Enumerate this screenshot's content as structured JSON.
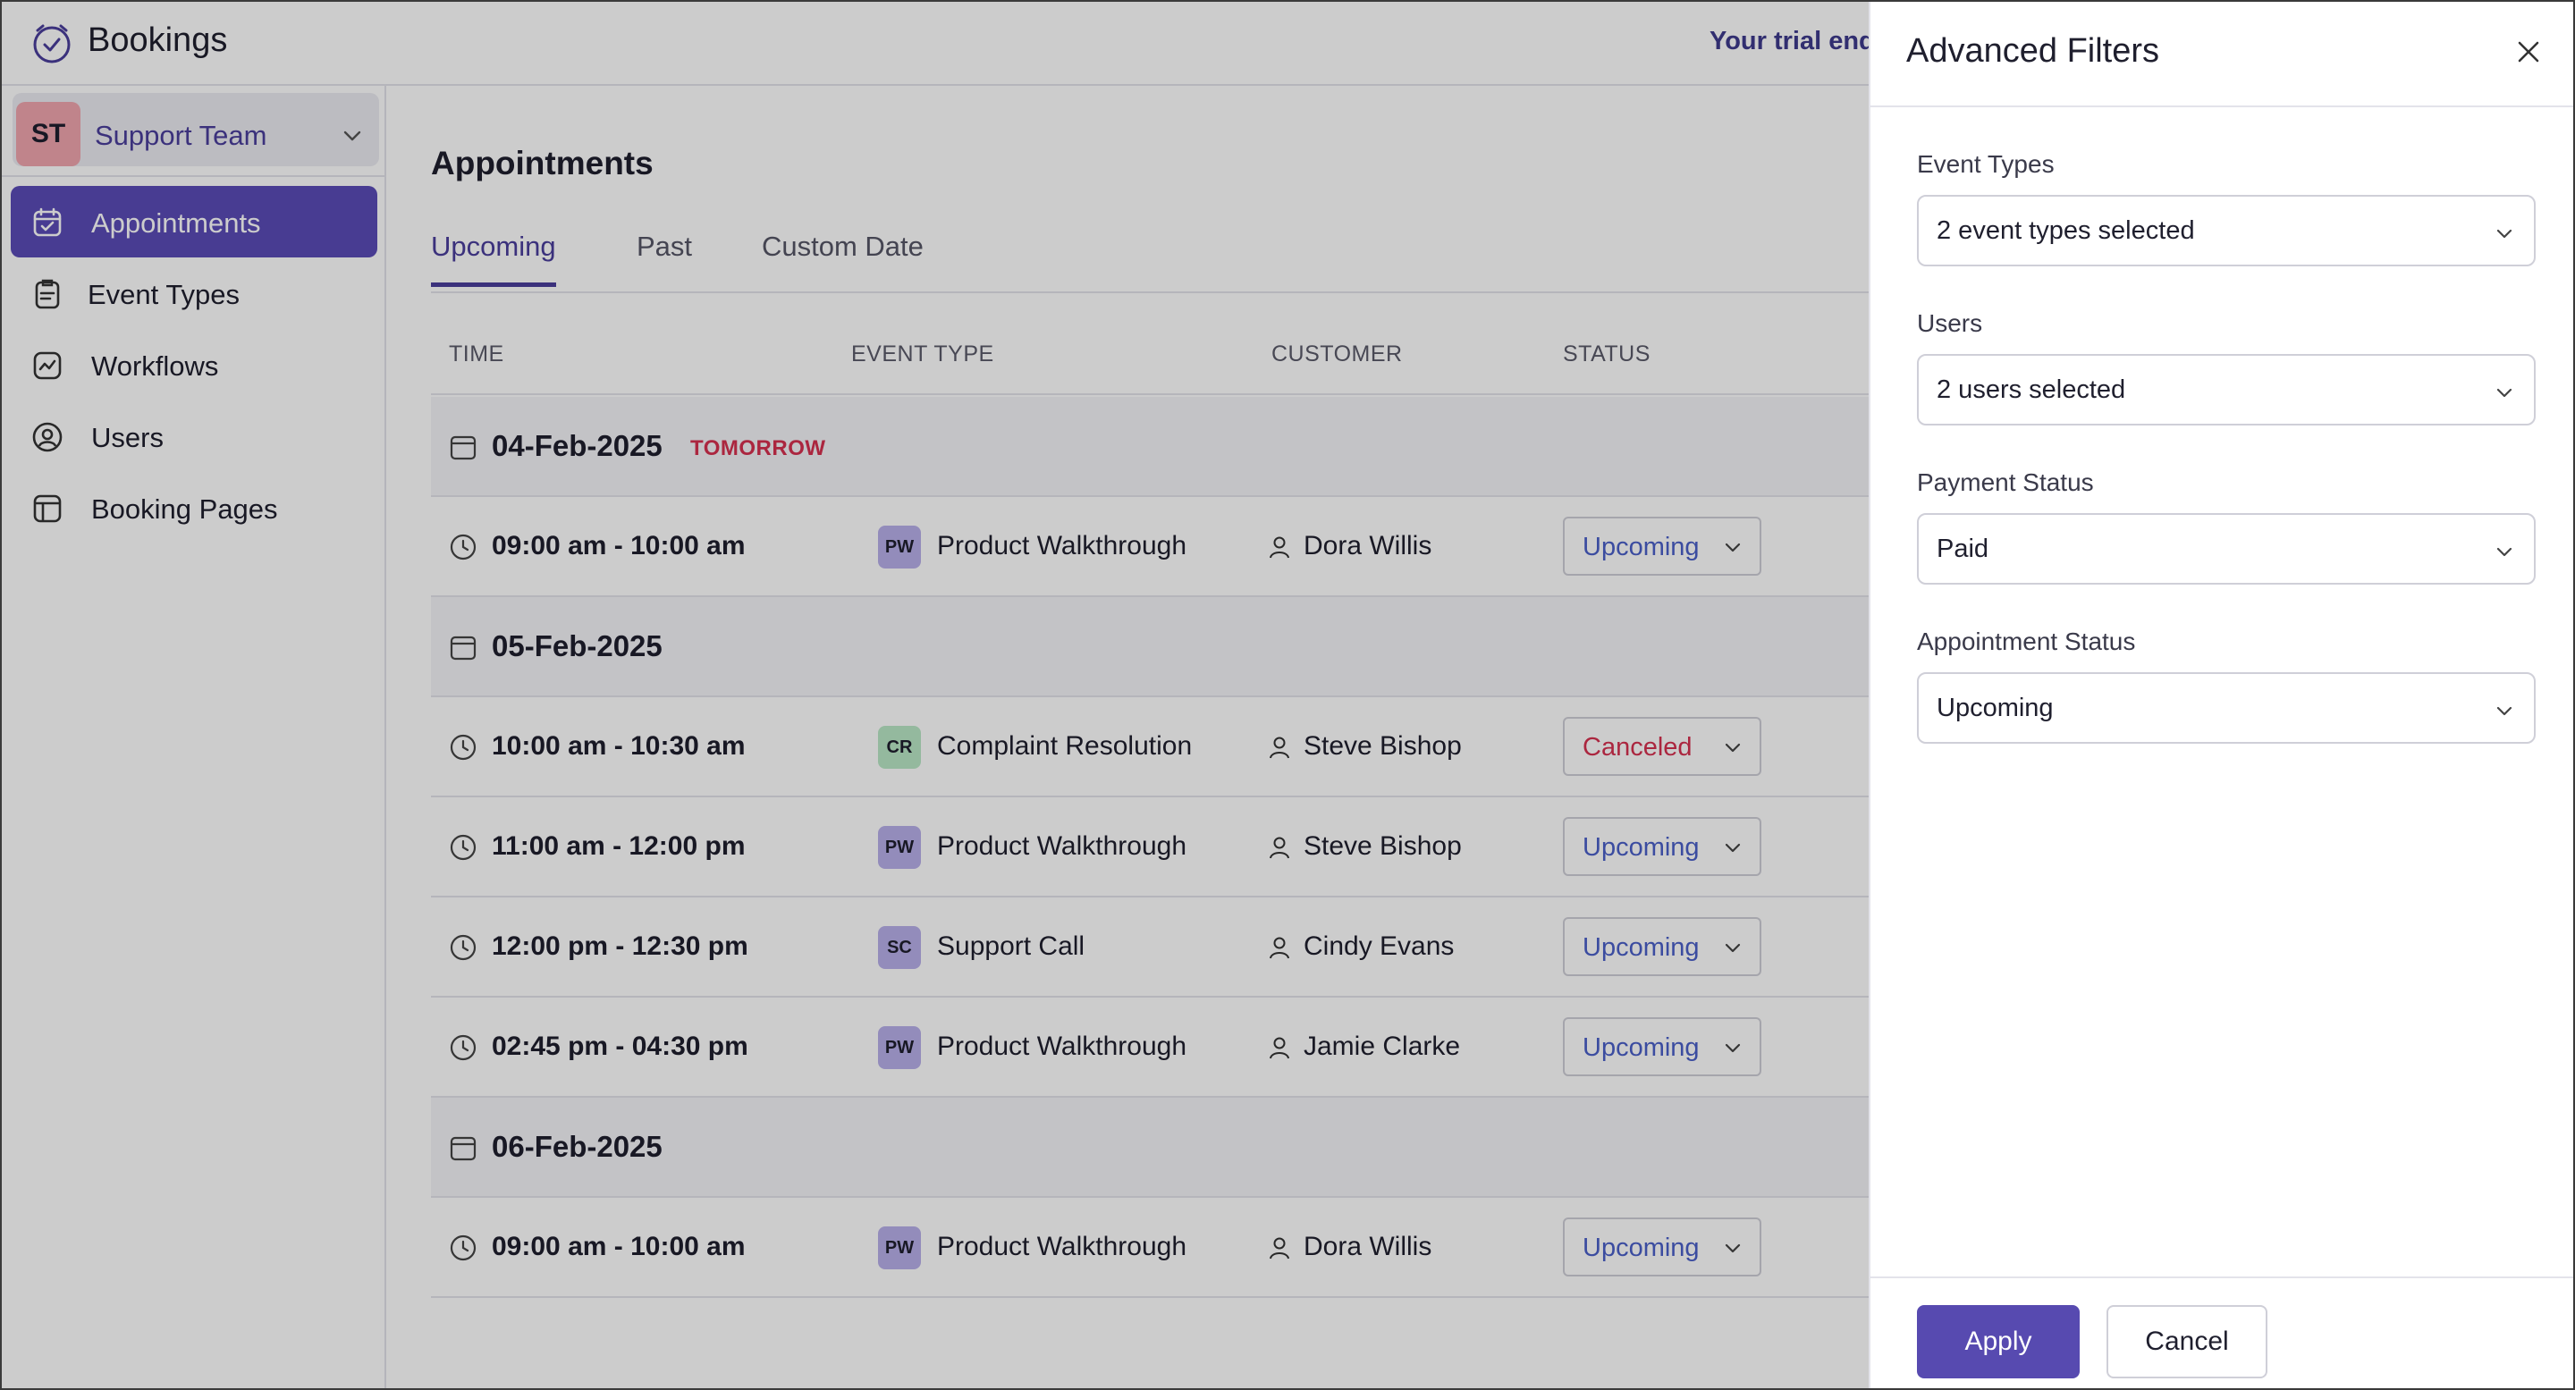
{
  "app": {
    "title": "Bookings",
    "trial_text": "Your trial ends"
  },
  "team": {
    "initials": "ST",
    "name": "Support Team"
  },
  "sidebar": {
    "items": [
      {
        "label": "Appointments",
        "icon": "calendar-check-icon",
        "active": true
      },
      {
        "label": "Event Types",
        "icon": "clipboard-icon",
        "active": false
      },
      {
        "label": "Workflows",
        "icon": "workflow-icon",
        "active": false
      },
      {
        "label": "Users",
        "icon": "user-circle-icon",
        "active": false
      },
      {
        "label": "Booking Pages",
        "icon": "layout-icon",
        "active": false
      }
    ]
  },
  "main": {
    "title": "Appointments",
    "tabs": [
      {
        "label": "Upcoming",
        "active": true
      },
      {
        "label": "Past",
        "active": false
      },
      {
        "label": "Custom Date",
        "active": false
      }
    ],
    "columns": [
      "TIME",
      "EVENT TYPE",
      "CUSTOMER",
      "STATUS"
    ],
    "groups": [
      {
        "date": "04-Feb-2025",
        "tag": "TOMORROW",
        "rows": [
          {
            "time": "09:00 am - 10:00 am",
            "badge": "PW",
            "event": "Product Walkthrough",
            "customer": "Dora Willis",
            "status": "Upcoming"
          }
        ]
      },
      {
        "date": "05-Feb-2025",
        "tag": "",
        "rows": [
          {
            "time": "10:00 am - 10:30 am",
            "badge": "CR",
            "event": "Complaint Resolution",
            "customer": "Steve Bishop",
            "status": "Canceled"
          },
          {
            "time": "11:00 am - 12:00 pm",
            "badge": "PW",
            "event": "Product Walkthrough",
            "customer": "Steve Bishop",
            "status": "Upcoming"
          },
          {
            "time": "12:00 pm - 12:30 pm",
            "badge": "SC",
            "event": "Support Call",
            "customer": "Cindy Evans",
            "status": "Upcoming"
          },
          {
            "time": "02:45 pm - 04:30 pm",
            "badge": "PW",
            "event": "Product Walkthrough",
            "customer": "Jamie Clarke",
            "status": "Upcoming"
          }
        ]
      },
      {
        "date": "06-Feb-2025",
        "tag": "",
        "rows": [
          {
            "time": "09:00 am - 10:00 am",
            "badge": "PW",
            "event": "Product Walkthrough",
            "customer": "Dora Willis",
            "status": "Upcoming"
          }
        ]
      }
    ]
  },
  "filters": {
    "title": "Advanced Filters",
    "fields": [
      {
        "label": "Event Types",
        "value": "2 event types selected"
      },
      {
        "label": "Users",
        "value": "2 users selected"
      },
      {
        "label": "Payment Status",
        "value": "Paid"
      },
      {
        "label": "Appointment Status",
        "value": "Upcoming"
      }
    ],
    "apply_label": "Apply",
    "cancel_label": "Cancel"
  },
  "colors": {
    "accent": "#5a4bb7",
    "status_upcoming": "#4a5fc9",
    "status_canceled": "#d6304f",
    "tomorrow": "#d6304f"
  }
}
